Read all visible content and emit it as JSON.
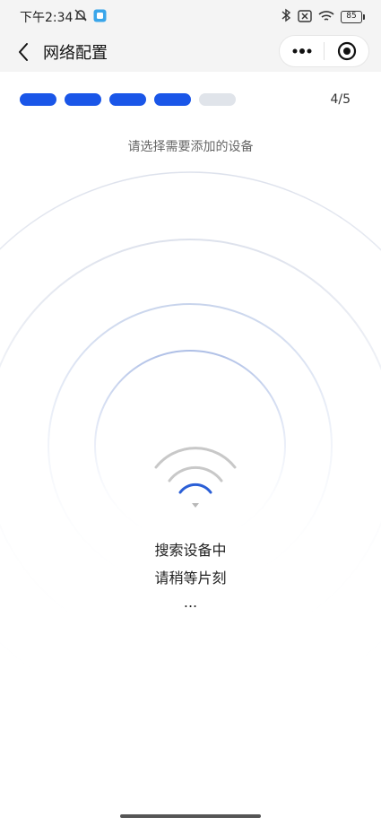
{
  "status_bar": {
    "time": "下午2:34",
    "battery": "85",
    "icons": [
      "mute-icon",
      "app-notification-icon",
      "bluetooth-icon",
      "sim-icon",
      "wifi-signal-icon",
      "battery-icon"
    ]
  },
  "nav": {
    "title": "网络配置",
    "back_icon": "back-arrow-icon",
    "more_icon": "more-dots-icon",
    "close_icon": "target-circle-icon"
  },
  "progress": {
    "total_steps": 5,
    "current_step": 4,
    "counter": "4/5",
    "active_color": "#1a56e8",
    "inactive_color": "#e0e4ea"
  },
  "instruction": "请选择需要添加的设备",
  "searching": {
    "line1": "搜索设备中",
    "line2": "请稍等片刻",
    "line3": "..."
  }
}
